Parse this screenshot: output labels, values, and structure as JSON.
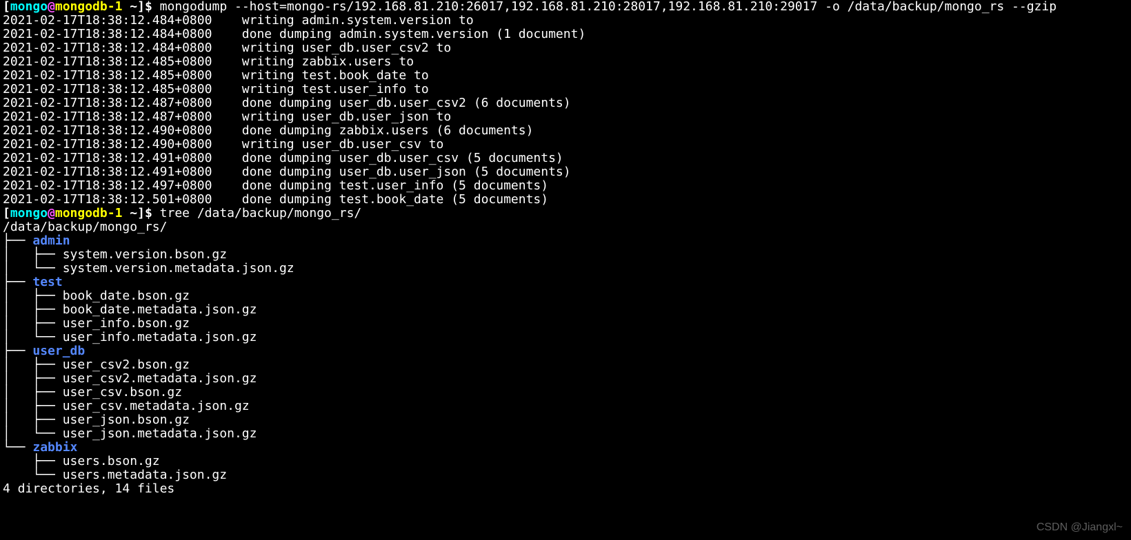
{
  "prompt": {
    "open": "[",
    "user": "mongo",
    "at": "@",
    "host": "mongodb-1",
    "path": " ~",
    "close": "]",
    "dollar": "$ "
  },
  "commands": {
    "mongodump": "mongodump --host=mongo-rs/192.168.81.210:26017,192.168.81.210:28017,192.168.81.210:29017 -o /data/backup/mongo_rs --gzip",
    "tree": "tree /data/backup/mongo_rs/"
  },
  "dump_output": [
    "2021-02-17T18:38:12.484+0800    writing admin.system.version to",
    "2021-02-17T18:38:12.484+0800    done dumping admin.system.version (1 document)",
    "2021-02-17T18:38:12.484+0800    writing user_db.user_csv2 to",
    "2021-02-17T18:38:12.485+0800    writing zabbix.users to",
    "2021-02-17T18:38:12.485+0800    writing test.book_date to",
    "2021-02-17T18:38:12.485+0800    writing test.user_info to",
    "2021-02-17T18:38:12.487+0800    done dumping user_db.user_csv2 (6 documents)",
    "2021-02-17T18:38:12.487+0800    writing user_db.user_json to",
    "2021-02-17T18:38:12.490+0800    done dumping zabbix.users (6 documents)",
    "2021-02-17T18:38:12.490+0800    writing user_db.user_csv to",
    "2021-02-17T18:38:12.491+0800    done dumping user_db.user_csv (5 documents)",
    "2021-02-17T18:38:12.491+0800    done dumping user_db.user_json (5 documents)",
    "2021-02-17T18:38:12.497+0800    done dumping test.user_info (5 documents)",
    "2021-02-17T18:38:12.501+0800    done dumping test.book_date (5 documents)"
  ],
  "tree": {
    "root": "/data/backup/mongo_rs/",
    "dirs": [
      {
        "name": "admin",
        "prefix": "├── ",
        "files": [
          {
            "pipe": "│   ├── ",
            "name": "system.version.bson.gz"
          },
          {
            "pipe": "│   └── ",
            "name": "system.version.metadata.json.gz"
          }
        ]
      },
      {
        "name": "test",
        "prefix": "├── ",
        "files": [
          {
            "pipe": "│   ├── ",
            "name": "book_date.bson.gz"
          },
          {
            "pipe": "│   ├── ",
            "name": "book_date.metadata.json.gz"
          },
          {
            "pipe": "│   ├── ",
            "name": "user_info.bson.gz"
          },
          {
            "pipe": "│   └── ",
            "name": "user_info.metadata.json.gz"
          }
        ]
      },
      {
        "name": "user_db",
        "prefix": "├── ",
        "files": [
          {
            "pipe": "│   ├── ",
            "name": "user_csv2.bson.gz"
          },
          {
            "pipe": "│   ├── ",
            "name": "user_csv2.metadata.json.gz"
          },
          {
            "pipe": "│   ├── ",
            "name": "user_csv.bson.gz"
          },
          {
            "pipe": "│   ├── ",
            "name": "user_csv.metadata.json.gz"
          },
          {
            "pipe": "│   ├── ",
            "name": "user_json.bson.gz"
          },
          {
            "pipe": "│   └── ",
            "name": "user_json.metadata.json.gz"
          }
        ]
      },
      {
        "name": "zabbix",
        "prefix": "└── ",
        "files": [
          {
            "pipe": "    ├── ",
            "name": "users.bson.gz"
          },
          {
            "pipe": "    └── ",
            "name": "users.metadata.json.gz"
          }
        ]
      }
    ],
    "summary": "4 directories, 14 files"
  },
  "watermark": "CSDN @Jiangxl~"
}
